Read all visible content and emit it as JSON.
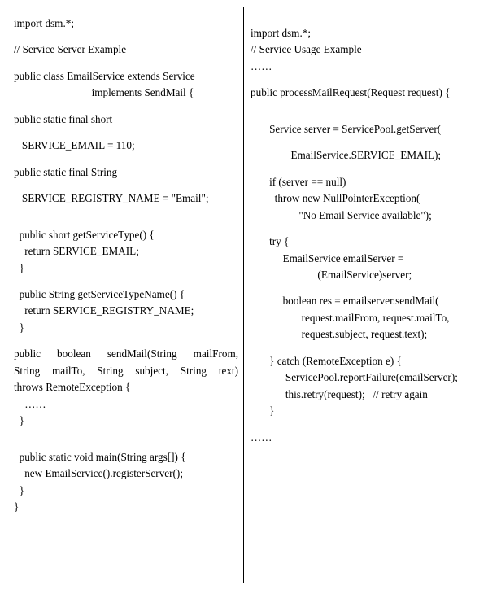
{
  "left": {
    "l0": "import dsm.*;",
    "l1": "// Service Server Example",
    "l2": "public class EmailService extends Service",
    "l3": "                             implements SendMail {",
    "l4": "public static final short",
    "l5": "   SERVICE_EMAIL = 110;",
    "l6": "public static final String",
    "l7": "   SERVICE_REGISTRY_NAME = \"Email\";",
    "l8": "  public short getServiceType() {",
    "l9": "    return SERVICE_EMAIL;",
    "l10": "  }",
    "l11": "  public String getServiceTypeName() {",
    "l12": "    return SERVICE_REGISTRY_NAME;",
    "l13": "  }",
    "l14a": "    public boolean sendMail(String mailFrom,",
    "l14b": "String mailTo, String subject, String text)",
    "l14c": "throws RemoteException {",
    "l15": "    ……",
    "l16": "  }",
    "l17": "  public static void main(String args[]) {",
    "l18": "    new EmailService().registerServer();",
    "l19": "  }",
    "l20": "}"
  },
  "right": {
    "r0": "import dsm.*;",
    "r1": "// Service Usage Example",
    "r2": "……",
    "r3": "public processMailRequest(Request request) {",
    "r4": "       Service server = ServicePool.getServer(",
    "r5": "               EmailService.SERVICE_EMAIL);",
    "r6": "       if (server == null)",
    "r7": "         throw new NullPointerException(",
    "r8": "                  \"No Email Service available\");",
    "r9": "       try {",
    "r10": "            EmailService emailServer =",
    "r11": "                         (EmailService)server;",
    "r12": "            boolean res = emailserver.sendMail(",
    "r13": "                   request.mailFrom, request.mailTo,",
    "r14": "                   request.subject, request.text);",
    "r15": "       } catch (RemoteException e) {",
    "r16": "             ServicePool.reportFailure(emailServer);",
    "r17": "             this.retry(request);   // retry again",
    "r18": "       }",
    "r19": "……"
  }
}
